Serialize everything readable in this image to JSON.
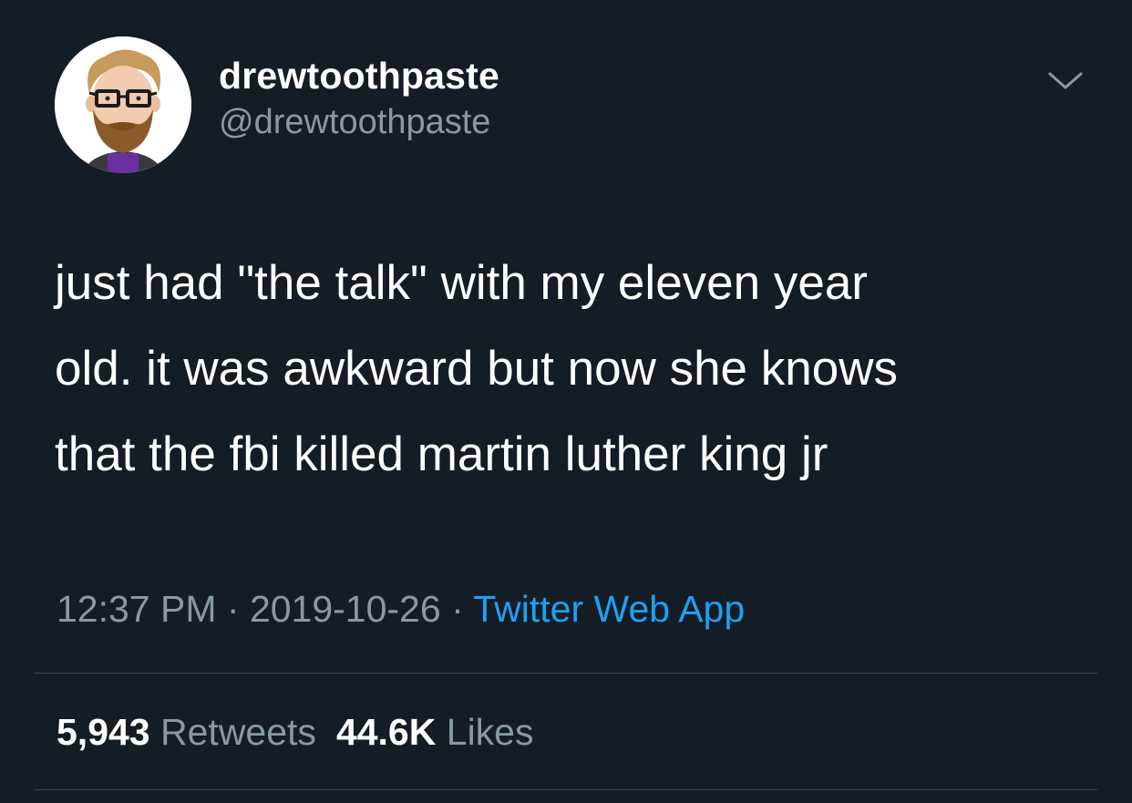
{
  "author": {
    "display_name": "drewtoothpaste",
    "handle": "@drewtoothpaste",
    "avatar_icon": "bearded-man-with-glasses-avatar"
  },
  "tweet": {
    "lines": [
      "just had \"the talk\" with my eleven year",
      "old. it was awkward but now she knows",
      "that the fbi killed martin luther king jr"
    ]
  },
  "meta": {
    "time": "12:37 PM",
    "separator": " · ",
    "date": "2019-10-26",
    "source": "Twitter Web App"
  },
  "stats": {
    "retweets_count": "5,943",
    "retweets_label": "Retweets",
    "likes_count": "44.6K",
    "likes_label": "Likes"
  },
  "colors": {
    "background": "#141d26",
    "text": "#ffffff",
    "secondary": "#8899a6",
    "link": "#1da1f2",
    "divider": "#38444d"
  }
}
